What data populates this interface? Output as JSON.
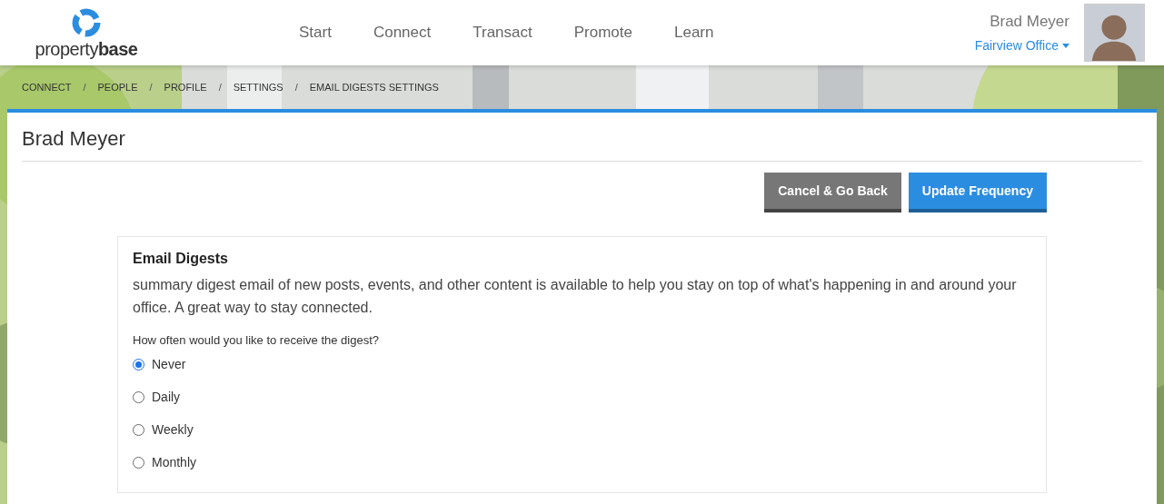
{
  "header": {
    "logo_text_light": "property",
    "logo_text_bold": "base",
    "nav": [
      {
        "label": "Start",
        "selected": false
      },
      {
        "label": "Connect",
        "selected": false
      },
      {
        "label": "Transact",
        "selected": false
      },
      {
        "label": "Promote",
        "selected": false
      },
      {
        "label": "Learn",
        "selected": false
      }
    ],
    "user": {
      "name": "Brad Meyer",
      "office": "Fairview Office"
    }
  },
  "breadcrumb": {
    "separator": "/",
    "items": [
      "CONNECT",
      "PEOPLE",
      "PROFILE",
      "SETTINGS",
      "EMAIL DIGESTS SETTINGS"
    ]
  },
  "page": {
    "title": "Brad Meyer",
    "buttons": [
      {
        "label": "Cancel & Go Back",
        "kind": "secondary"
      },
      {
        "label": "Update Frequency",
        "kind": "primary"
      }
    ],
    "panel": {
      "title": "Email Digests",
      "description": "summary digest email of new posts, events, and other content is available to help you stay on top of what's happening in and around your office. A great way to stay connected.",
      "question": "How often would you like to receive the digest?",
      "options": [
        {
          "label": "Never",
          "selected": true
        },
        {
          "label": "Daily",
          "selected": false
        },
        {
          "label": "Weekly",
          "selected": false
        },
        {
          "label": "Monthly",
          "selected": false
        }
      ]
    }
  }
}
